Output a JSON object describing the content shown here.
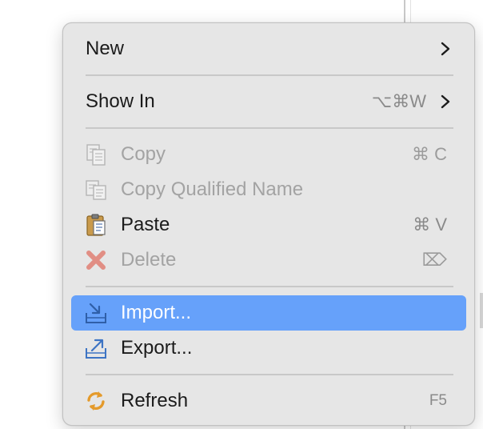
{
  "menu": {
    "items": [
      {
        "id": "new",
        "label": "New",
        "shortcut": "",
        "submenu": true,
        "enabled": true,
        "icon": ""
      },
      {
        "id": "show-in",
        "label": "Show In",
        "shortcut": "⌥⌘W",
        "submenu": true,
        "enabled": true,
        "icon": ""
      },
      {
        "id": "copy",
        "label": "Copy",
        "shortcut": "⌘ C",
        "submenu": false,
        "enabled": false,
        "icon": "copy-icon"
      },
      {
        "id": "copy-qualified-name",
        "label": "Copy Qualified Name",
        "shortcut": "",
        "submenu": false,
        "enabled": false,
        "icon": "copy-qualified-name-icon"
      },
      {
        "id": "paste",
        "label": "Paste",
        "shortcut": "⌘ V",
        "submenu": false,
        "enabled": true,
        "icon": "clipboard-icon"
      },
      {
        "id": "delete",
        "label": "Delete",
        "shortcut": "⌦",
        "submenu": false,
        "enabled": false,
        "icon": "delete-x-icon"
      },
      {
        "id": "import",
        "label": "Import...",
        "shortcut": "",
        "submenu": false,
        "enabled": true,
        "highlighted": true,
        "icon": "import-tray-icon"
      },
      {
        "id": "export",
        "label": "Export...",
        "shortcut": "",
        "submenu": false,
        "enabled": true,
        "icon": "export-tray-icon"
      },
      {
        "id": "refresh",
        "label": "Refresh",
        "shortcut": "F5",
        "submenu": false,
        "enabled": true,
        "icon": "refresh-arrows-icon"
      }
    ]
  },
  "colors": {
    "menu_background": "#e6e6e6",
    "highlight": "#66a1fa",
    "text": "#1b1b1b",
    "disabled_text": "#a3a3a3",
    "separator": "#c8c8c8",
    "delete_red": "#e06a5c",
    "refresh_orange": "#e49a2b",
    "tray_blue": "#3d74c4"
  }
}
